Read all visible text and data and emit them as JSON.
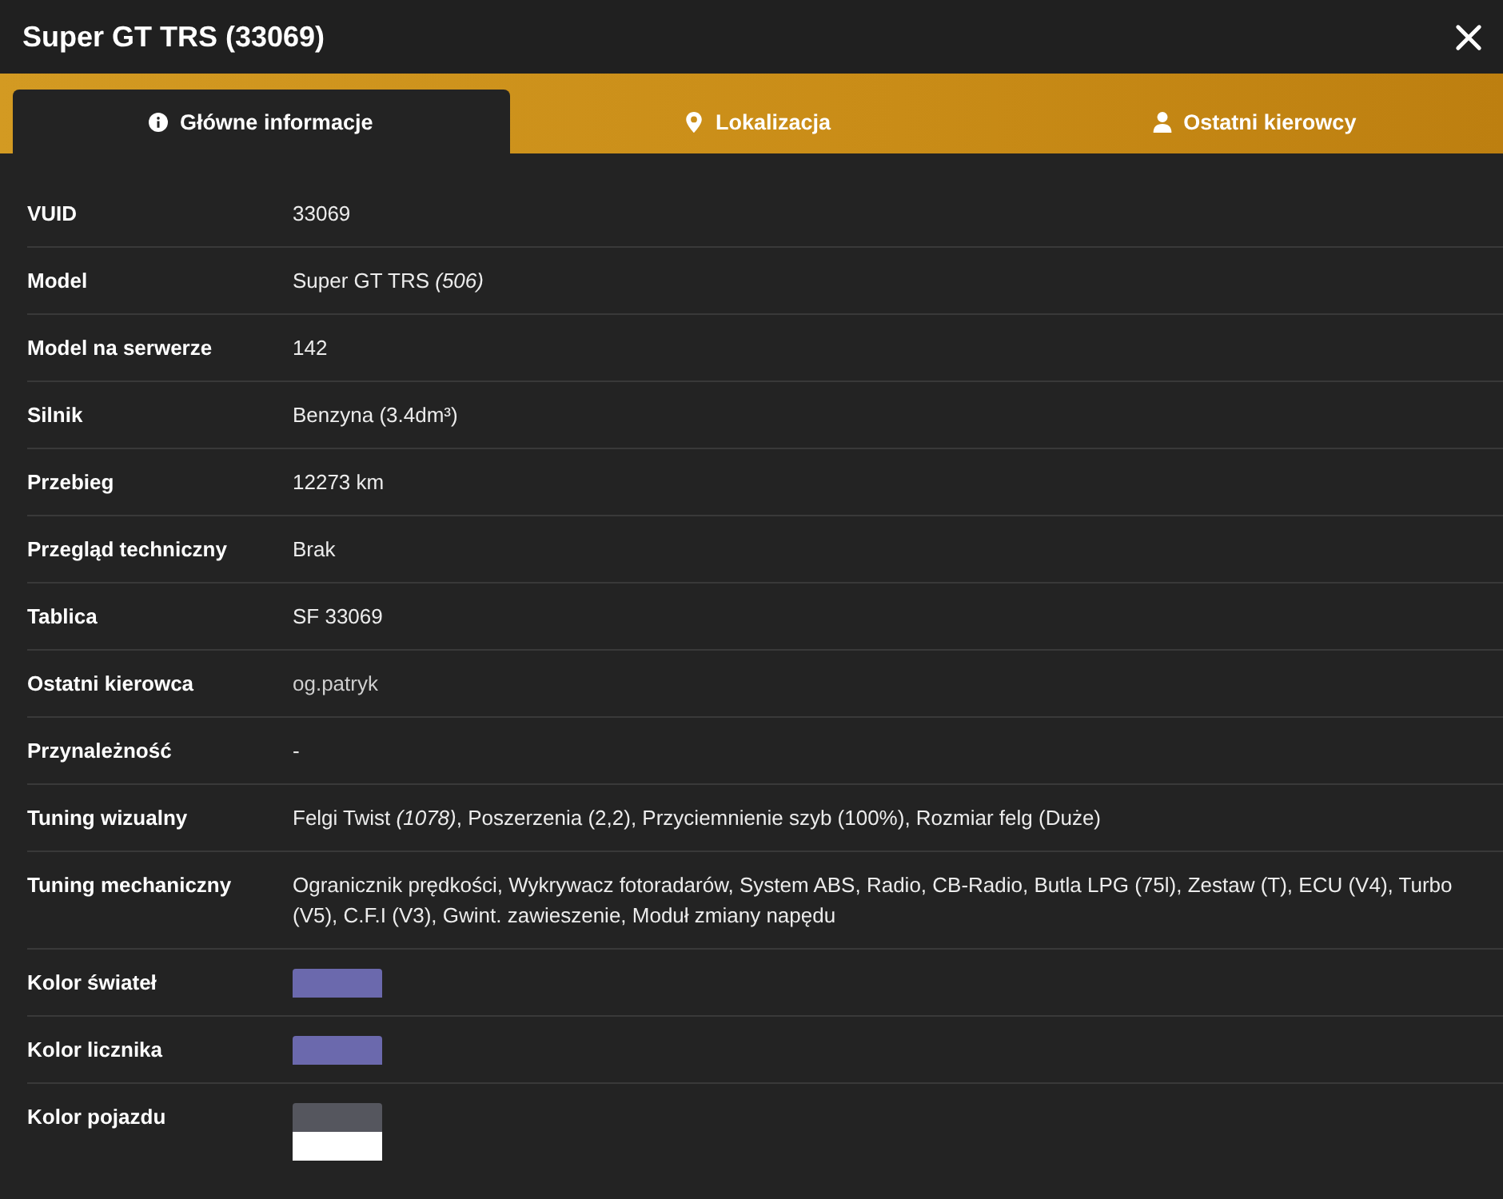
{
  "window": {
    "title": "Super GT TRS (33069)"
  },
  "tabs": [
    {
      "label": "Główne informacje",
      "selected": true
    },
    {
      "label": "Lokalizacja",
      "selected": false
    },
    {
      "label": "Ostatni kierowcy",
      "selected": false
    }
  ],
  "rows": [
    {
      "kind": "text",
      "label": "VUID",
      "value": "33069"
    },
    {
      "kind": "text",
      "label": "Model",
      "value": "Super GT TRS *(506)*"
    },
    {
      "kind": "text",
      "label": "Model na serwerze",
      "value": "142"
    },
    {
      "kind": "text",
      "label": "Silnik",
      "value": "Benzyna (3.4dm³)"
    },
    {
      "kind": "text",
      "label": "Przebieg",
      "value": "12273 km"
    },
    {
      "kind": "text",
      "label": "Przegląd techniczny",
      "value": "Brak"
    },
    {
      "kind": "text",
      "label": "Tablica",
      "value": "SF 33069"
    },
    {
      "kind": "link",
      "label": "Ostatni kierowca",
      "value": "og.patryk"
    },
    {
      "kind": "text",
      "label": "Przynależność",
      "value": "-"
    },
    {
      "kind": "text",
      "label": "Tuning wizualny",
      "value": "Felgi Twist *(1078)*, Poszerzenia (2,2), Przyciemnienie szyb (100%), Rozmiar felg (Duże)"
    },
    {
      "kind": "text",
      "label": "Tuning mechaniczny",
      "value": "Ogranicznik prędkości, Wykrywacz fotoradarów, System ABS, Radio, CB-Radio, Butla LPG (75l), Zestaw (T), ECU (V4), Turbo (V5), C.F.I (V3), Gwint. zawieszenie, Moduł zmiany napędu"
    },
    {
      "kind": "swatches",
      "label": "Kolor świateł",
      "swatches": [
        {
          "color": "#6b69ad"
        }
      ]
    },
    {
      "kind": "swatches",
      "label": "Kolor licznika",
      "swatches": [
        {
          "color": "#6b69ad"
        }
      ]
    },
    {
      "kind": "swatches",
      "label": "Kolor pojazdu",
      "swatches": [
        {
          "color": "#55565e"
        },
        {
          "color": "#ffffff"
        }
      ]
    }
  ]
}
